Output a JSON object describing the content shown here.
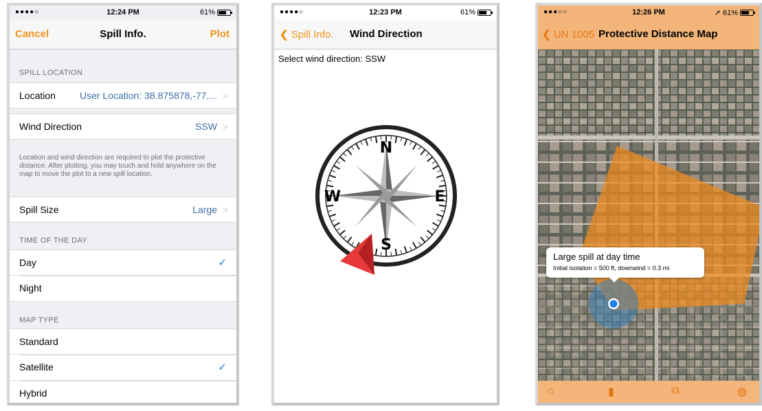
{
  "status": {
    "carrier1": "●●●●○",
    "time1": "12:24 PM",
    "battery1": "61%",
    "carrier2": "●●●●○",
    "time2": "12:23 PM",
    "battery2": "61%",
    "carrier3": "●●●○○",
    "time3": "12:26 PM",
    "battery3": "61%"
  },
  "spill_info": {
    "nav": {
      "left": "Cancel",
      "title": "Spill Info.",
      "right": "Plot"
    },
    "section_spill_location": "SPILL LOCATION",
    "location_label": "Location",
    "location_value": "User Location: 38.875878,-77....",
    "wind_label": "Wind Direction",
    "wind_value": "SSW",
    "footnote": "Location and wind direction are required to plot the protective distance. After plotting, you may touch and hold anywhere on the map to move the plot to a new spill location.",
    "spill_size_label": "Spill Size",
    "spill_size_value": "Large",
    "section_time": "TIME OF THE DAY",
    "time_options": [
      "Day",
      "Night"
    ],
    "section_map": "MAP TYPE",
    "map_options": [
      "Standard",
      "Satellite",
      "Hybrid"
    ]
  },
  "wind_direction": {
    "nav": {
      "back": "Spill Info.",
      "title": "Wind Direction"
    },
    "prompt": "Select wind direction: SSW",
    "compass": {
      "n": "N",
      "e": "E",
      "s": "S",
      "w": "W",
      "selected": "SSW"
    }
  },
  "map_screen": {
    "nav": {
      "back": "UN 1005",
      "title": "Protective Distance Map"
    },
    "callout_title": "Large spill at day time",
    "callout_detail": "Initial isolation = 500 ft, downwind = 0.3 mi"
  },
  "icons": {
    "chevron": "chevron-right-icon",
    "check": "checkmark-icon",
    "home": "home-icon",
    "book": "book-icon",
    "layers": "layers-icon",
    "globe": "globe-icon"
  },
  "colors": {
    "accent": "#f0921e",
    "link": "#3b6ea5",
    "check": "#1a7ee0",
    "bar": "#f3b57a",
    "plume": "#f08a1c"
  }
}
